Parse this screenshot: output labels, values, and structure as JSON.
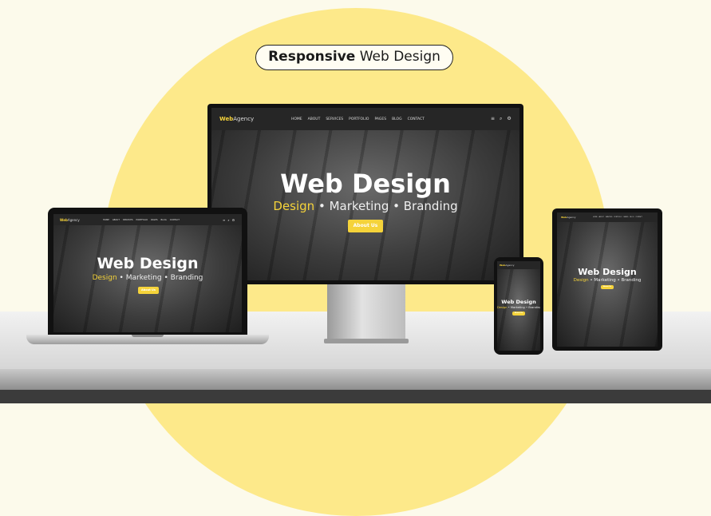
{
  "heading": {
    "bold": "Responsive",
    "rest": "Web Design"
  },
  "site": {
    "logo_brand": "Web",
    "logo_rest": "Agency",
    "menu": [
      "HOME",
      "ABOUT",
      "SERVICES",
      "PORTFOLIO",
      "PAGES",
      "BLOG",
      "CONTACT"
    ],
    "hero_title": "Web Design",
    "tagline": {
      "first": "Design",
      "second": "Marketing",
      "third": "Branding",
      "separator": "•"
    },
    "button_label": "About Us",
    "nav_icons": [
      "menu-icon",
      "search-icon",
      "settings-icon"
    ]
  },
  "colors": {
    "accent": "#f5d33a",
    "sun": "#fde98a",
    "background": "#fcfaeb",
    "nav": "#262626"
  }
}
